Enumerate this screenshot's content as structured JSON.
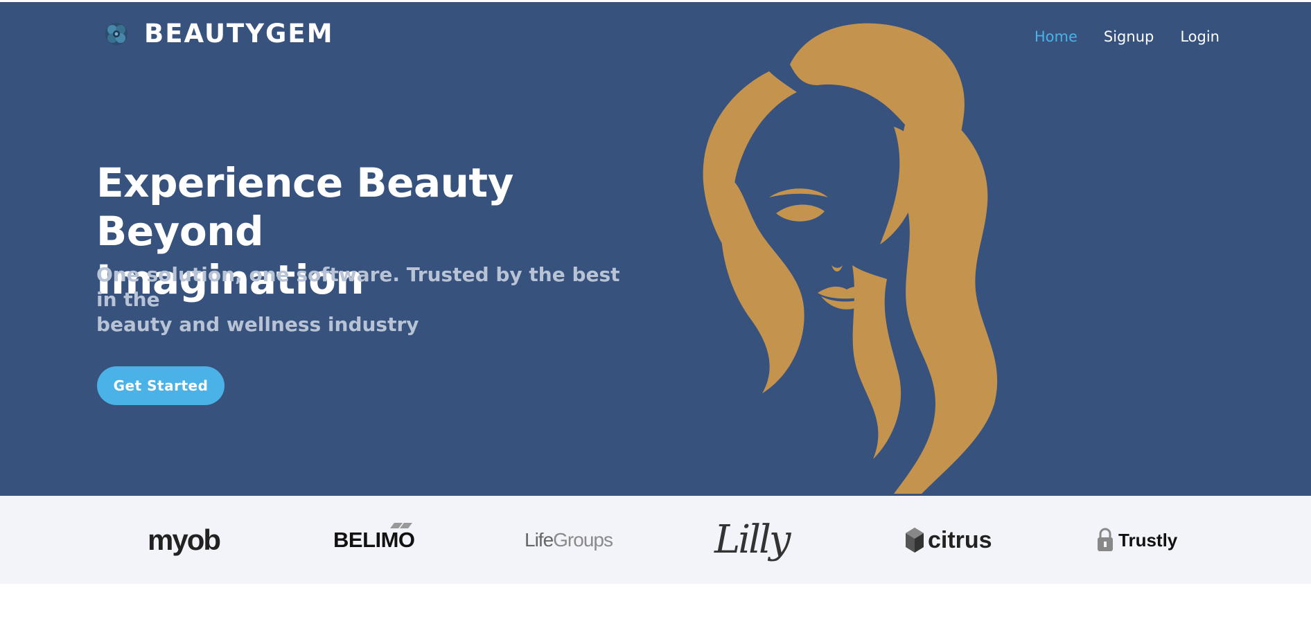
{
  "brand": {
    "name": "BEAUTYGEM",
    "icon": "flower-orb-icon"
  },
  "nav": {
    "items": [
      {
        "label": "Home",
        "active": true
      },
      {
        "label": "Signup",
        "active": false
      },
      {
        "label": "Login",
        "active": false
      }
    ]
  },
  "hero": {
    "headline_line1": "Experience Beauty Beyond",
    "headline_line2": "Imagination",
    "subhead_line1": "One solution, one software. Trusted by the best in the",
    "subhead_line2": "beauty and wellness industry",
    "cta_label": "Get Started",
    "illustration": "woman-face-hair-illustration"
  },
  "logos": {
    "items": [
      {
        "name": "myob",
        "text": "myob"
      },
      {
        "name": "belimo",
        "text": "BELIMO"
      },
      {
        "name": "lifegroups",
        "text_a": "Life",
        "text_b": "Groups"
      },
      {
        "name": "lilly",
        "text": "Lilly"
      },
      {
        "name": "citrus",
        "text": "citrus"
      },
      {
        "name": "trustly",
        "text": "Trustly"
      }
    ]
  },
  "colors": {
    "hero_bg": "#37527d",
    "accent": "#4ab2e6",
    "hair": "#c4944f",
    "logo_strip_bg": "#f3f4f9"
  }
}
